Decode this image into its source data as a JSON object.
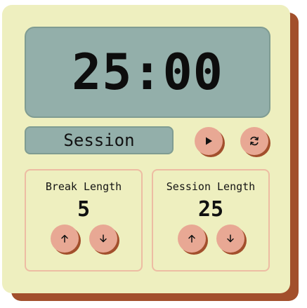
{
  "timer": {
    "time": "25:00",
    "mode": "Session"
  },
  "controls": {
    "play_icon": "play-icon",
    "reset_icon": "refresh-icon"
  },
  "break_panel": {
    "title": "Break Length",
    "value": "5",
    "up_icon": "arrow-up-icon",
    "down_icon": "arrow-down-icon"
  },
  "session_panel": {
    "title": "Session Length",
    "value": "25",
    "up_icon": "arrow-up-icon",
    "down_icon": "arrow-down-icon"
  },
  "colors": {
    "card": "#eeefbf",
    "shadow": "#a24f2c",
    "display": "#93afaa",
    "button": "#e8a894",
    "panel_border": "#edbca3"
  }
}
